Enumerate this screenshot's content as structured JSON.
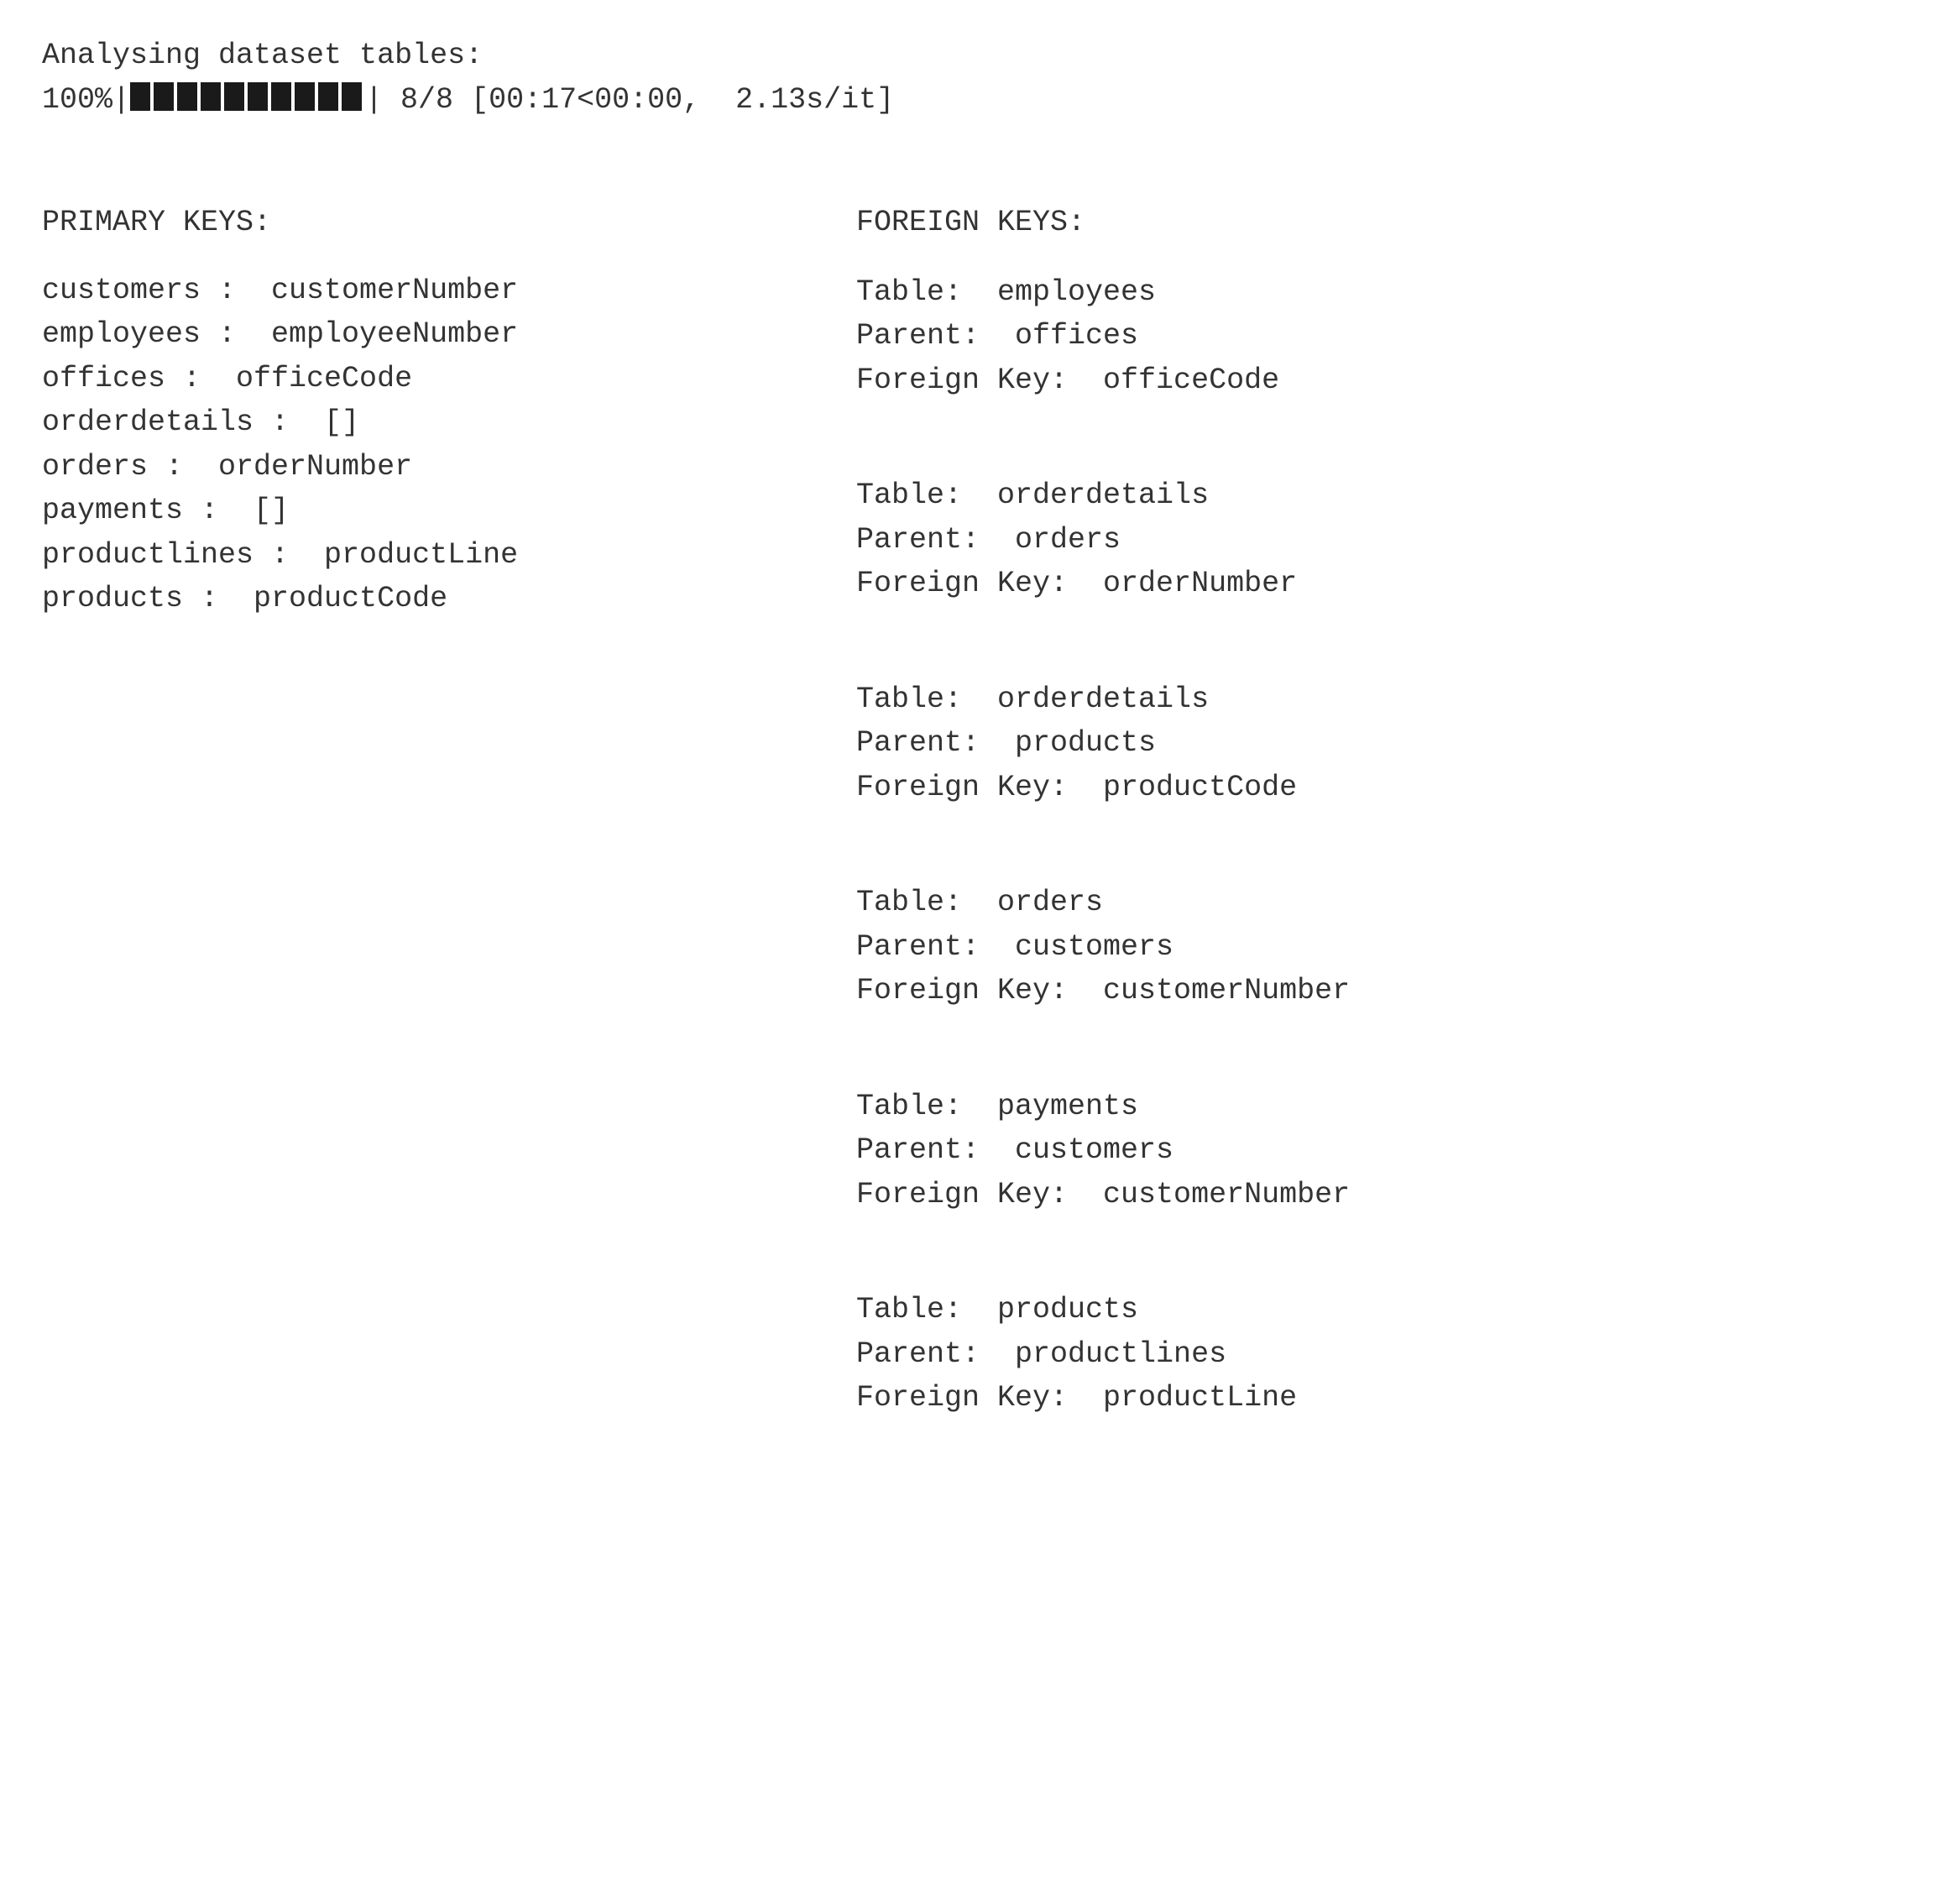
{
  "header": {
    "title": "Analysing dataset tables:",
    "progress_percent": "100%",
    "progress_bar_segments": 10,
    "progress_stats": " 8/8 [00:17<00:00,  2.13s/it]"
  },
  "primary_keys": {
    "title": "PRIMARY KEYS:",
    "items": [
      {
        "table": "customers",
        "key": "customerNumber"
      },
      {
        "table": "employees",
        "key": "employeeNumber"
      },
      {
        "table": "offices",
        "key": "officeCode"
      },
      {
        "table": "orderdetails",
        "key": "[]"
      },
      {
        "table": "orders",
        "key": "orderNumber"
      },
      {
        "table": "payments",
        "key": "[]"
      },
      {
        "table": "productlines",
        "key": "productLine"
      },
      {
        "table": "products",
        "key": "productCode"
      }
    ]
  },
  "foreign_keys": {
    "title": "FOREIGN KEYS:",
    "labels": {
      "table": "Table:",
      "parent": "Parent:",
      "fk": "Foreign Key:"
    },
    "items": [
      {
        "table": "employees",
        "parent": "offices",
        "fk": "officeCode"
      },
      {
        "table": "orderdetails",
        "parent": "orders",
        "fk": "orderNumber"
      },
      {
        "table": "orderdetails",
        "parent": "products",
        "fk": "productCode"
      },
      {
        "table": "orders",
        "parent": "customers",
        "fk": "customerNumber"
      },
      {
        "table": "payments",
        "parent": "customers",
        "fk": "customerNumber"
      },
      {
        "table": "products",
        "parent": "productlines",
        "fk": "productLine"
      }
    ]
  }
}
